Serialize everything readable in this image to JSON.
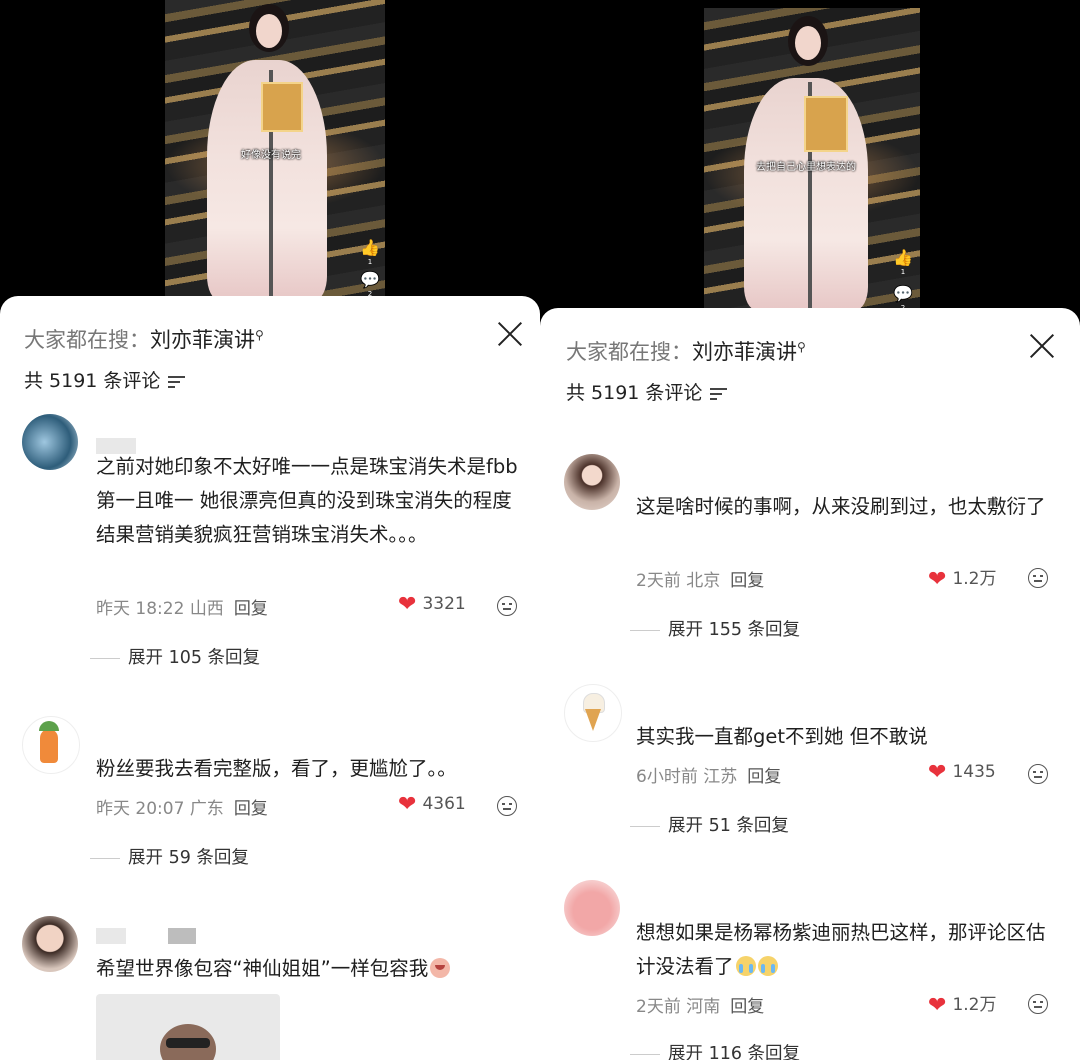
{
  "left": {
    "video": {
      "subtitle": "好像没有说完",
      "like_count": "1",
      "comment_count": "2"
    },
    "search": {
      "prefix": "大家都在搜：",
      "term": "刘亦菲演讲"
    },
    "comment_count_label": "共 5191 条评论",
    "comments": [
      {
        "text": "之前对她印象不太好唯一一点是珠宝消失术是fbb第一且唯一 她很漂亮但真的没到珠宝消失的程度 结果营销美貌疯狂营销珠宝消失术。。。",
        "time": "昨天 18:22",
        "location": "山西",
        "reply": "回复",
        "likes": "3321",
        "expand": "展开 105 条回复"
      },
      {
        "text": "粉丝要我去看完整版，看了，更尴尬了。。",
        "time": "昨天 20:07",
        "location": "广东",
        "reply": "回复",
        "likes": "4361",
        "expand": "展开 59 条回复"
      },
      {
        "text": "希望世界像包容“神仙姐姐”一样包容我"
      }
    ]
  },
  "right": {
    "video": {
      "subtitle": "去把自己心里想表达的",
      "like_count": "1",
      "comment_count": "2"
    },
    "search": {
      "prefix": "大家都在搜：",
      "term": "刘亦菲演讲"
    },
    "comment_count_label": "共 5191 条评论",
    "comments": [
      {
        "text": "这是啥时候的事啊，从来没刷到过，也太敷衍了",
        "time": "2天前",
        "location": "北京",
        "reply": "回复",
        "likes": "1.2万",
        "expand": "展开 155 条回复"
      },
      {
        "text": "其实我一直都get不到她 但不敢说",
        "time": "6小时前",
        "location": "江苏",
        "reply": "回复",
        "likes": "1435",
        "expand": "展开 51 条回复"
      },
      {
        "text": "想想如果是杨幂杨紫迪丽热巴这样，那评论区估计没法看了",
        "time": "2天前",
        "location": "河南",
        "reply": "回复",
        "likes": "1.2万",
        "expand": "展开 116 条回复"
      }
    ]
  }
}
